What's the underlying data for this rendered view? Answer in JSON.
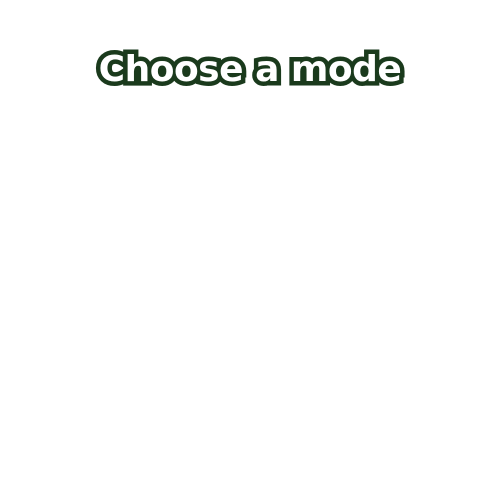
{
  "title": "Choose a mode",
  "colors": {
    "background": "#ffffff",
    "title_fill": "#ffffff",
    "title_outline": "#1a3a1c"
  }
}
